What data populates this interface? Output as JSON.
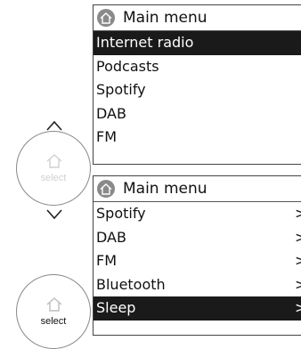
{
  "top_screen": {
    "title": "Main menu",
    "items": [
      {
        "label": "Internet radio",
        "selected": true
      },
      {
        "label": "Podcasts",
        "selected": false
      },
      {
        "label": "Spotify",
        "selected": false
      },
      {
        "label": "DAB",
        "selected": false
      },
      {
        "label": "FM",
        "selected": false
      }
    ]
  },
  "bottom_screen": {
    "title": "Main menu",
    "items": [
      {
        "label": "Spotify",
        "arrow": ">",
        "selected": false
      },
      {
        "label": "DAB",
        "arrow": ">",
        "selected": false
      },
      {
        "label": "FM",
        "arrow": ">",
        "selected": false
      },
      {
        "label": "Bluetooth",
        "arrow": ">",
        "selected": false
      },
      {
        "label": "Sleep",
        "arrow": ">",
        "selected": true
      }
    ]
  },
  "controls": {
    "select_button_1": {
      "label": "select",
      "state": "inactive",
      "icon": "home-icon"
    },
    "select_button_2": {
      "label": "select",
      "state": "active",
      "icon": "home-icon"
    },
    "up_arrow_icon": "chevron-up-icon",
    "down_arrow_icon": "chevron-down-icon"
  },
  "colors": {
    "selected_bg": "#1a1a1a",
    "selected_text": "#ffffff",
    "header_icon_bg": "#8a8a8a",
    "inactive_label": "#d0d0d0"
  }
}
